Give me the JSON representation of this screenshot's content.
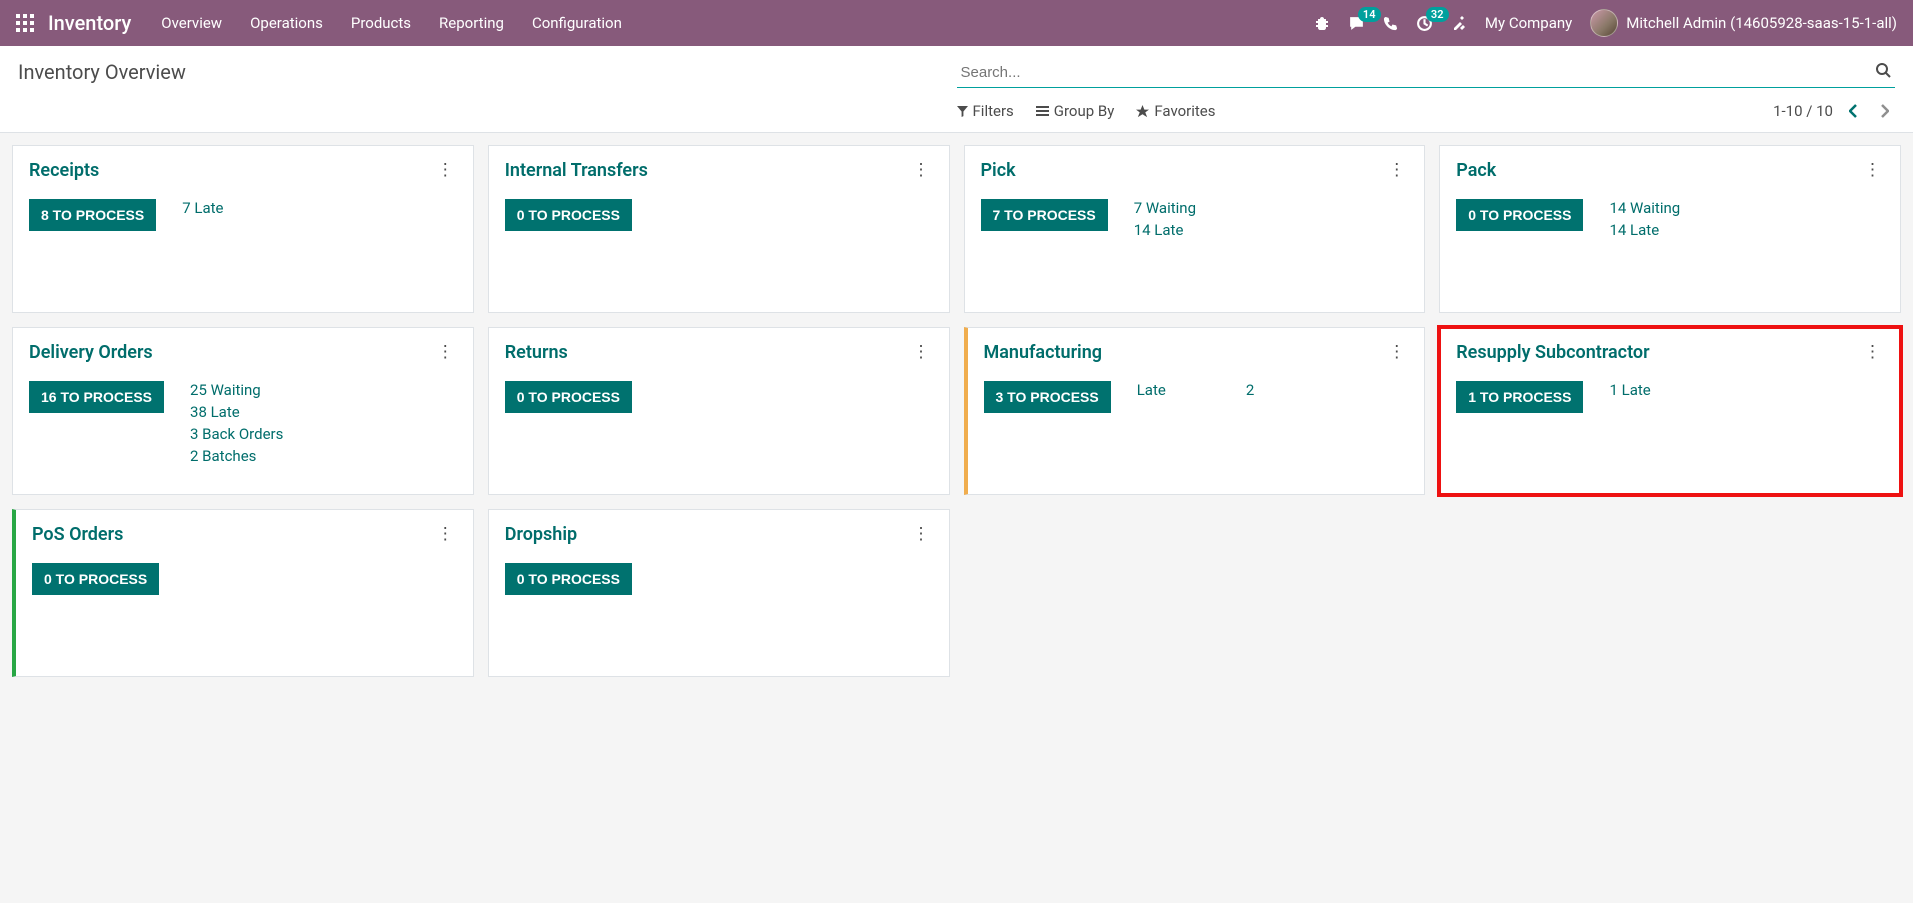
{
  "nav": {
    "brand": "Inventory",
    "menu": [
      "Overview",
      "Operations",
      "Products",
      "Reporting",
      "Configuration"
    ],
    "messages_badge": "14",
    "activity_badge": "32",
    "company": "My Company",
    "user": "Mitchell Admin (14605928-saas-15-1-all)"
  },
  "page": {
    "title": "Inventory Overview",
    "search_placeholder": "Search...",
    "filters_label": "Filters",
    "groupby_label": "Group By",
    "favorites_label": "Favorites",
    "pager": "1-10 / 10"
  },
  "cards": {
    "receipts": {
      "title": "Receipts",
      "button": "8 TO PROCESS",
      "stats": [
        "7 Late"
      ]
    },
    "internal": {
      "title": "Internal Transfers",
      "button": "0 TO PROCESS",
      "stats": []
    },
    "pick": {
      "title": "Pick",
      "button": "7 TO PROCESS",
      "stats": [
        "7 Waiting",
        "14 Late"
      ]
    },
    "pack": {
      "title": "Pack",
      "button": "0 TO PROCESS",
      "stats": [
        "14 Waiting",
        "14 Late"
      ]
    },
    "delivery": {
      "title": "Delivery Orders",
      "button": "16 TO PROCESS",
      "stats": [
        "25 Waiting",
        "38 Late",
        "3 Back Orders",
        "2 Batches"
      ]
    },
    "returns": {
      "title": "Returns",
      "button": "0 TO PROCESS",
      "stats": []
    },
    "manufacturing": {
      "title": "Manufacturing",
      "button": "3 TO PROCESS",
      "row_label": "Late",
      "row_value": "2"
    },
    "resupply": {
      "title": "Resupply Subcontractor",
      "button": "1 TO PROCESS",
      "stats": [
        "1 Late"
      ]
    },
    "pos": {
      "title": "PoS Orders",
      "button": "0 TO PROCESS",
      "stats": []
    },
    "dropship": {
      "title": "Dropship",
      "button": "0 TO PROCESS",
      "stats": []
    }
  }
}
